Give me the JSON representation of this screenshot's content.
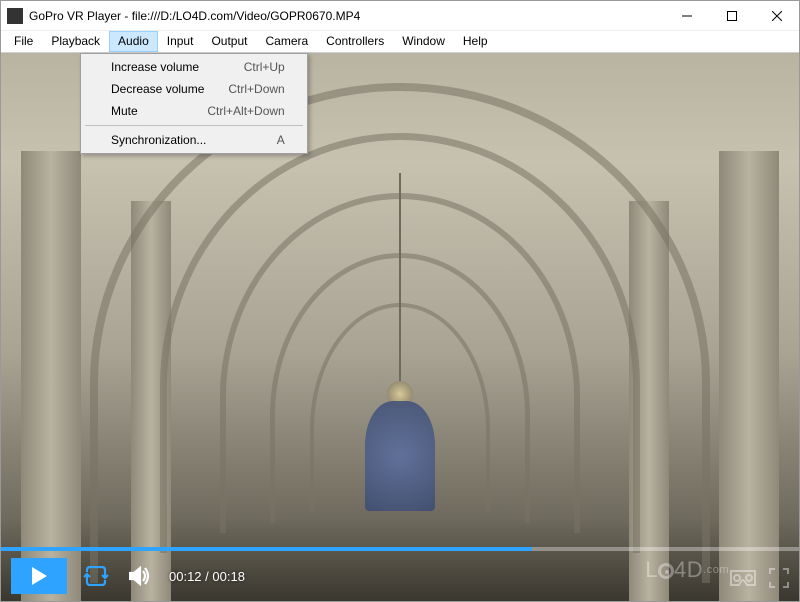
{
  "titlebar": {
    "app_name": "GoPro VR Player",
    "separator": " - ",
    "file_url": "file:///D:/LO4D.com/Video/GOPR0670.MP4"
  },
  "menubar": {
    "items": [
      "File",
      "Playback",
      "Audio",
      "Input",
      "Output",
      "Camera",
      "Controllers",
      "Window",
      "Help"
    ],
    "open_index": 2
  },
  "dropdown": {
    "items": [
      {
        "label": "Increase volume",
        "shortcut": "Ctrl+Up"
      },
      {
        "label": "Decrease volume",
        "shortcut": "Ctrl+Down"
      },
      {
        "label": "Mute",
        "shortcut": "Ctrl+Alt+Down"
      }
    ],
    "after_sep": [
      {
        "label": "Synchronization...",
        "shortcut": "A"
      }
    ]
  },
  "player": {
    "current_time": "00:12",
    "duration": "00:18",
    "time_sep": " / ",
    "progress_percent": 66.6,
    "accent": "#2ea3ff"
  },
  "icons": {
    "play": "play-icon",
    "loop": "loop-icon",
    "volume": "volume-icon",
    "minimize": "minimize-icon",
    "maximize": "maximize-icon",
    "close": "close-icon",
    "cardboard": "vr-cardboard-icon",
    "fullscreen": "fullscreen-icon"
  },
  "watermark": {
    "text_prefix": "L",
    "text_mid": "4D",
    "text_suffix": ".com"
  }
}
